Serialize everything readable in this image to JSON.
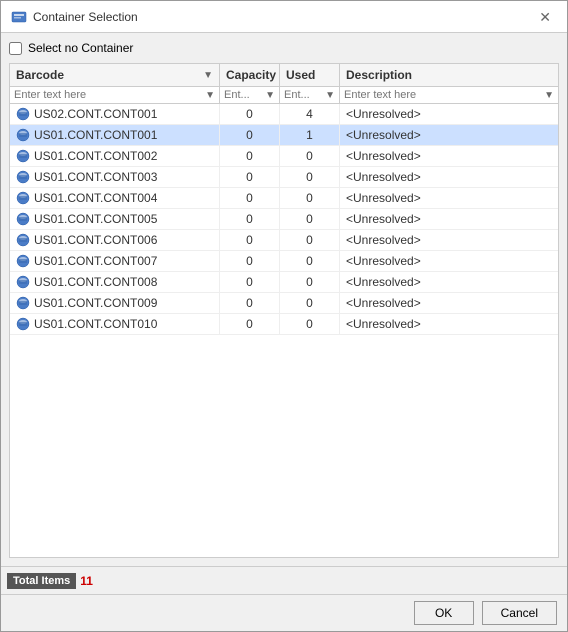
{
  "dialog": {
    "title": "Container Selection",
    "icon": "container-icon"
  },
  "checkbox": {
    "label": "Select no Container",
    "checked": false
  },
  "table": {
    "columns": [
      {
        "key": "barcode",
        "label": "Barcode",
        "sortable": true
      },
      {
        "key": "capacity",
        "label": "Capacity",
        "sortable": false
      },
      {
        "key": "used",
        "label": "Used",
        "sortable": false
      },
      {
        "key": "description",
        "label": "Description",
        "sortable": false
      }
    ],
    "filters": {
      "barcode": "Enter text here",
      "capacity": "Ent...",
      "used": "Ent...",
      "description": "Enter text here"
    },
    "rows": [
      {
        "barcode": "US02.CONT.CONT001",
        "capacity": "0",
        "used": "4",
        "description": "<Unresolved>"
      },
      {
        "barcode": "US01.CONT.CONT001",
        "capacity": "0",
        "used": "1",
        "description": "<Unresolved>"
      },
      {
        "barcode": "US01.CONT.CONT002",
        "capacity": "0",
        "used": "0",
        "description": "<Unresolved>"
      },
      {
        "barcode": "US01.CONT.CONT003",
        "capacity": "0",
        "used": "0",
        "description": "<Unresolved>"
      },
      {
        "barcode": "US01.CONT.CONT004",
        "capacity": "0",
        "used": "0",
        "description": "<Unresolved>"
      },
      {
        "barcode": "US01.CONT.CONT005",
        "capacity": "0",
        "used": "0",
        "description": "<Unresolved>"
      },
      {
        "barcode": "US01.CONT.CONT006",
        "capacity": "0",
        "used": "0",
        "description": "<Unresolved>"
      },
      {
        "barcode": "US01.CONT.CONT007",
        "capacity": "0",
        "used": "0",
        "description": "<Unresolved>"
      },
      {
        "barcode": "US01.CONT.CONT008",
        "capacity": "0",
        "used": "0",
        "description": "<Unresolved>"
      },
      {
        "barcode": "US01.CONT.CONT009",
        "capacity": "0",
        "used": "0",
        "description": "<Unresolved>"
      },
      {
        "barcode": "US01.CONT.CONT010",
        "capacity": "0",
        "used": "0",
        "description": "<Unresolved>"
      }
    ]
  },
  "status_bar": {
    "label": "Total Items",
    "value": "11"
  },
  "footer": {
    "ok_label": "OK",
    "cancel_label": "Cancel"
  }
}
